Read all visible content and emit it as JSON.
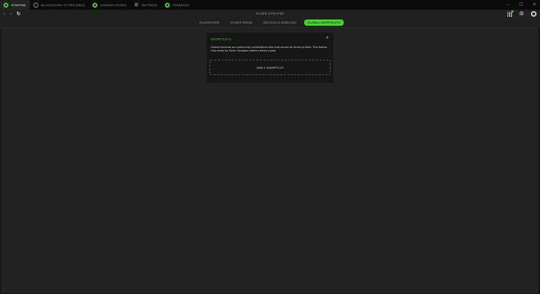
{
  "tabs": [
    {
      "label": "SYNAPSE",
      "icon": "razer-logo-icon",
      "active": true
    },
    {
      "label": "BLACKSHARK V2 PRO (2023)",
      "icon": "headset-icon",
      "active": false
    },
    {
      "label": "CHROMA STUDIO",
      "icon": "chroma-icon",
      "active": false
    },
    {
      "label": "SETTINGS",
      "icon": "gear-icon",
      "active": false
    },
    {
      "label": "FEEDBACK",
      "icon": "feedback-icon",
      "active": false
    }
  ],
  "window_controls": {
    "minimize": "–",
    "maximize": "☐",
    "close": "✕"
  },
  "nav": {
    "back": "‹",
    "forward": "›",
    "refresh": "↻",
    "title": "RAZER SYNAPSE"
  },
  "subtabs": [
    {
      "label": "DASHBOARD",
      "active": false
    },
    {
      "label": "GAMES ROOM",
      "active": false
    },
    {
      "label": "DEVICES & MODULES",
      "active": false
    },
    {
      "label": "GLOBAL SHORTCUTS",
      "active": true
    }
  ],
  "card": {
    "title": "SHORTCUTS",
    "add_icon": "+",
    "description": "Global shortcuts are custom key combinations that work across all device profiles. This feature only works for Razer Synapse-enabled device inputs.",
    "add_button": "ADD A SHORTCUT"
  },
  "colors": {
    "accent": "#44d62c",
    "background": "#222222",
    "card": "#161616",
    "titlebar": "#0b0b0b"
  }
}
